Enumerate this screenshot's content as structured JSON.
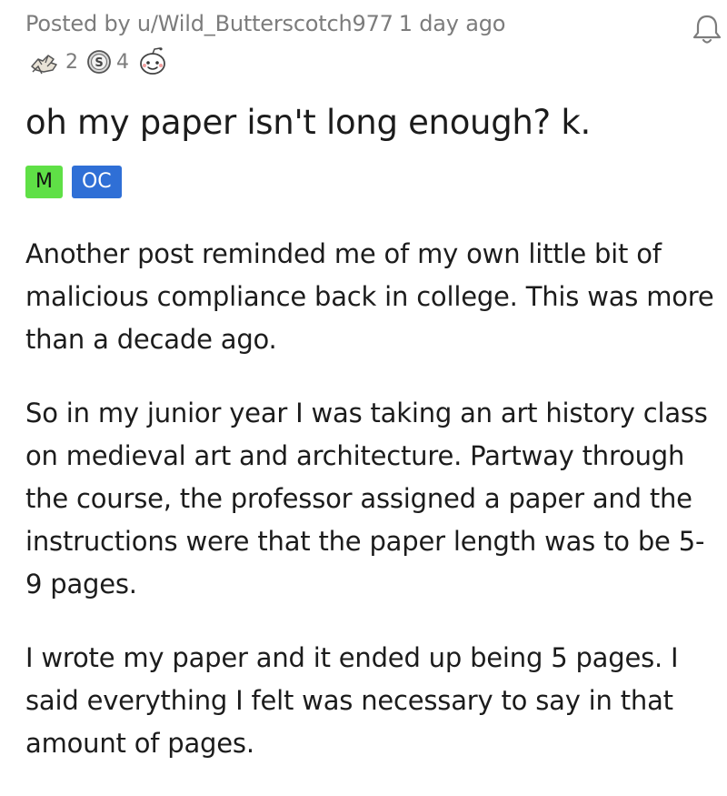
{
  "post": {
    "meta": {
      "posted_by": "Posted by u/Wild_Butterscotch977",
      "time": "1 day ago"
    },
    "awards": [
      {
        "icon": "helping-hand-award-icon",
        "count": "2"
      },
      {
        "icon": "silver-award-icon",
        "count": "4"
      },
      {
        "icon": "wholesome-award-icon",
        "count": ""
      }
    ],
    "title": "oh my paper isn't long enough? k.",
    "flairs": [
      {
        "label": "M",
        "color": "#5fe046"
      },
      {
        "label": "OC",
        "color": "#2f6fd6"
      }
    ],
    "paragraphs": [
      "Another post reminded me of my own little bit of malicious compliance back in college. This was more than a decade ago.",
      "So in my junior year I was taking an art history class on medieval art and architecture. Partway through the course, the professor assigned a paper and the instructions were that the paper length was to be 5-9 pages.",
      "I wrote my paper and it ended up being 5 pages. I said everything I felt was necessary to say in that amount of pages."
    ]
  },
  "icons": {
    "bell": "bell-icon"
  }
}
